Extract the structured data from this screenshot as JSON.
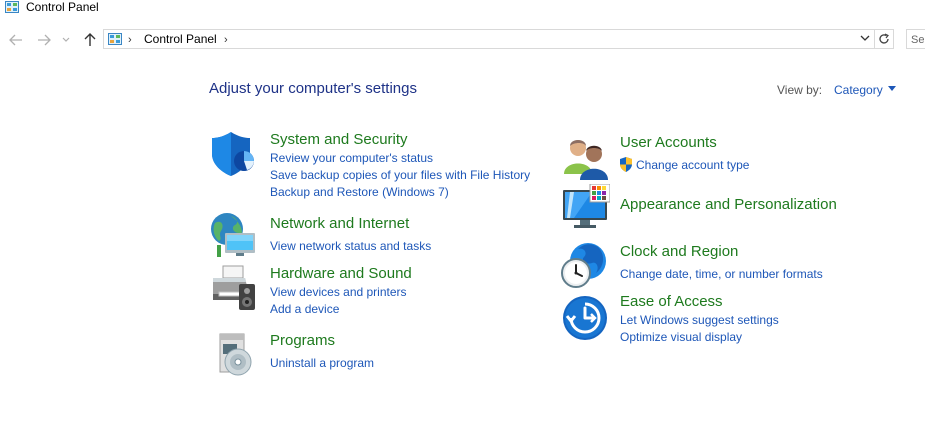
{
  "window": {
    "title": "Control Panel"
  },
  "address_bar": {
    "breadcrumb": "Control Panel",
    "separator": "›"
  },
  "search": {
    "placeholder": "Search Control Panel"
  },
  "page": {
    "heading": "Adjust your computer's settings",
    "view_by_label": "View by:",
    "view_by_value": "Category"
  },
  "categories_left": [
    {
      "title": "System and Security",
      "icon": "shield-icon",
      "links": [
        "Review your computer's status",
        "Save backup copies of your files with File History",
        "Backup and Restore (Windows 7)"
      ]
    },
    {
      "title": "Network and Internet",
      "icon": "globe-network-icon",
      "links": [
        "View network status and tasks"
      ]
    },
    {
      "title": "Hardware and Sound",
      "icon": "printer-speaker-icon",
      "links": [
        "View devices and printers",
        "Add a device"
      ]
    },
    {
      "title": "Programs",
      "icon": "programs-disc-icon",
      "links": [
        "Uninstall a program"
      ]
    }
  ],
  "categories_right": [
    {
      "title": "User Accounts",
      "icon": "users-icon",
      "links": [
        "Change account type"
      ]
    },
    {
      "title": "Appearance and Personalization",
      "icon": "monitor-palette-icon",
      "links": []
    },
    {
      "title": "Clock and Region",
      "icon": "clock-globe-icon",
      "links": [
        "Change date, time, or number formats"
      ]
    },
    {
      "title": "Ease of Access",
      "icon": "ease-of-access-icon",
      "links": [
        "Let Windows suggest settings",
        "Optimize visual display"
      ]
    }
  ],
  "colors": {
    "heading": "#1e3287",
    "category_title": "#1e7a1e",
    "link": "#1e57b8"
  }
}
